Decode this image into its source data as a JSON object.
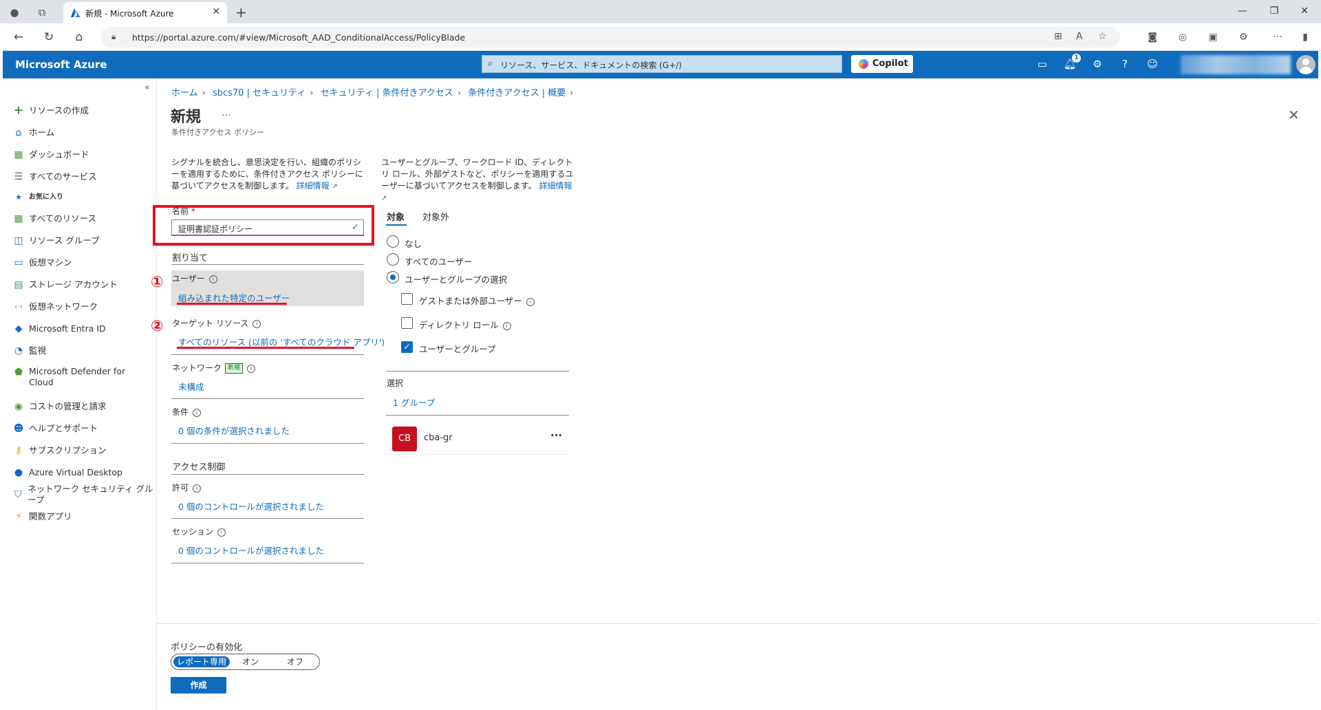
{
  "browser": {
    "tab_title": "新規 - Microsoft Azure",
    "url": "https://portal.azure.com/#view/Microsoft_AAD_ConditionalAccess/PolicyBlade"
  },
  "topbar": {
    "brand": "Microsoft Azure",
    "search_placeholder": "リソース、サービス、ドキュメントの検索 (G+/)",
    "copilot_label": "Copilot",
    "notification_count": "1"
  },
  "sidebar": {
    "items": [
      {
        "label": "リソースの作成",
        "icon": "plus-icon"
      },
      {
        "label": "ホーム",
        "icon": "home-icon"
      },
      {
        "label": "ダッシュボード",
        "icon": "dashboard-icon"
      },
      {
        "label": "すべてのサービス",
        "icon": "list-icon"
      },
      {
        "label": "お気に入り",
        "icon": "star-icon"
      },
      {
        "label": "すべてのリソース",
        "icon": "grid-icon"
      },
      {
        "label": "リソース グループ",
        "icon": "resource-group-icon"
      },
      {
        "label": "仮想マシン",
        "icon": "vm-icon"
      },
      {
        "label": "ストレージ アカウント",
        "icon": "storage-icon"
      },
      {
        "label": "仮想ネットワーク",
        "icon": "vnet-icon"
      },
      {
        "label": "Microsoft Entra ID",
        "icon": "entra-icon"
      },
      {
        "label": "監視",
        "icon": "monitor-icon"
      },
      {
        "label": "Microsoft Defender for Cloud",
        "icon": "defender-icon"
      },
      {
        "label": "コストの管理と請求",
        "icon": "cost-icon"
      },
      {
        "label": "ヘルプとサポート",
        "icon": "help-support-icon"
      },
      {
        "label": "サブスクリプション",
        "icon": "key-icon"
      },
      {
        "label": "Azure Virtual Desktop",
        "icon": "avd-icon"
      },
      {
        "label": "ネットワーク セキュリティ グループ",
        "icon": "nsg-icon"
      },
      {
        "label": "関数アプリ",
        "icon": "function-icon"
      }
    ]
  },
  "breadcrumb": [
    "ホーム",
    "sbcs70 | セキュリティ",
    "セキュリティ | 条件付きアクセス",
    "条件付きアクセス | 概要"
  ],
  "page": {
    "title": "新規",
    "subtitle": "条件付きアクセス ポリシー",
    "more": "...",
    "left_desc": "シグナルを統合し、意思決定を行い、組織のポリシーを適用するために、条件付きアクセス ポリシーに基づいてアクセスを制御します。",
    "right_desc": "ユーザーとグループ、ワークロード ID、ディレクトリ ロール、外部ゲストなど、ポリシーを適用するユーザーに基づいてアクセスを制御します。",
    "learn_more": "詳細情報"
  },
  "form": {
    "name_label": "名前",
    "name_required": "*",
    "name_value": "証明書認証ポリシー",
    "assignments": "割り当て",
    "users_label": "ユーザー",
    "users_value": "組み込まれた特定のユーザー",
    "target_label": "ターゲット リソース",
    "target_value": "すべてのリソース (以前の 'すべてのクラウド アプリ')",
    "network_label": "ネットワーク",
    "network_badge": "新規",
    "network_value": "未構成",
    "conditions_label": "条件",
    "conditions_value": "0 個の条件が選択されました",
    "access_controls": "アクセス制御",
    "grant_label": "許可",
    "grant_value": "0 個のコントロールが選択されました",
    "session_label": "セッション",
    "session_value": "0 個のコントロールが選択されました",
    "annot1": "①",
    "annot2": "②"
  },
  "include": {
    "tab_include": "対象",
    "tab_exclude": "対象外",
    "opt_none": "なし",
    "opt_all": "すべてのユーザー",
    "opt_select": "ユーザーとグループの選択",
    "selected_option": "opt_select",
    "cb_guest": "ゲストまたは外部ユーザー",
    "cb_roles": "ディレクトリ ロール",
    "cb_users_groups": "ユーザーとグループ",
    "select_label": "選択",
    "select_value": "1 グループ",
    "group_initials": "CB",
    "group_name": "cba-gr",
    "group_more": "···"
  },
  "footer": {
    "enable_label": "ポリシーの有効化",
    "opt_report": "レポート専用",
    "opt_on": "オン",
    "opt_off": "オフ",
    "selected": "レポート専用",
    "create": "作成"
  },
  "colors": {
    "azure_blue": "#0f6cbd",
    "highlight_red": "#e81123"
  }
}
